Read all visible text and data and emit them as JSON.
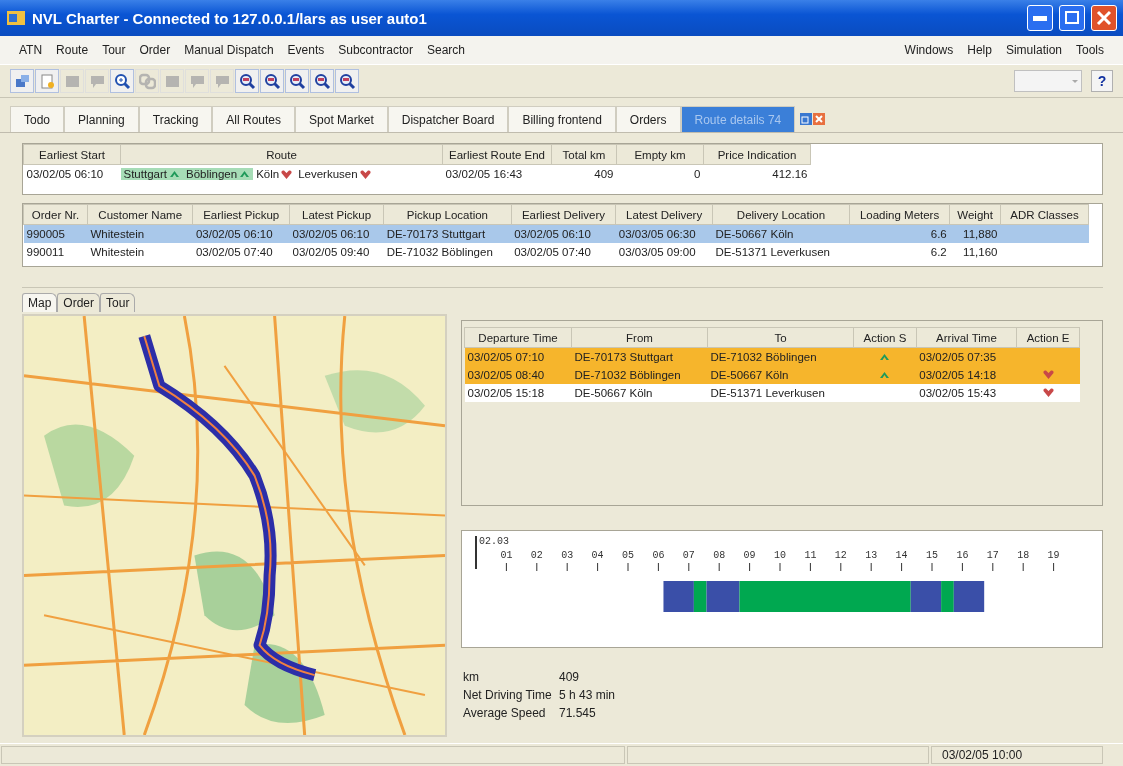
{
  "window": {
    "title": "NVL Charter - Connected to 127.0.0.1/lars as user auto1"
  },
  "menu": {
    "left": [
      "ATN",
      "Route",
      "Tour",
      "Order",
      "Manual Dispatch",
      "Events",
      "Subcontractor",
      "Search"
    ],
    "right": [
      "Windows",
      "Help",
      "Simulation",
      "Tools"
    ]
  },
  "toolbar": [
    {
      "kind": "window",
      "disabled": false
    },
    {
      "kind": "new",
      "disabled": false
    },
    {
      "kind": "grid",
      "disabled": true
    },
    {
      "kind": "note",
      "disabled": true
    },
    {
      "kind": "zoom",
      "disabled": false
    },
    {
      "kind": "link",
      "disabled": true
    },
    {
      "kind": "grid",
      "disabled": true
    },
    {
      "kind": "note",
      "disabled": true
    },
    {
      "kind": "note",
      "disabled": true
    },
    {
      "kind": "search",
      "disabled": false
    },
    {
      "kind": "search",
      "disabled": false
    },
    {
      "kind": "search",
      "disabled": false
    },
    {
      "kind": "search",
      "disabled": false
    },
    {
      "kind": "search",
      "disabled": false
    }
  ],
  "combo": {
    "disabled": true
  },
  "help_button": "?",
  "tabs": [
    {
      "label": "Todo",
      "selected": false
    },
    {
      "label": "Planning",
      "selected": false
    },
    {
      "label": "Tracking",
      "selected": false
    },
    {
      "label": "All Routes",
      "selected": false
    },
    {
      "label": "Spot Market",
      "selected": false
    },
    {
      "label": "Dispatcher Board",
      "selected": false
    },
    {
      "label": "Billing frontend",
      "selected": false
    },
    {
      "label": "Orders",
      "selected": false
    },
    {
      "label": "Route details 74",
      "selected": true
    }
  ],
  "route_table": {
    "columns": [
      "Earliest Start",
      "Route",
      "Earliest Route End",
      "Total km",
      "Empty km",
      "Price Indication"
    ],
    "row": {
      "earliest_start": "03/02/05 06:10",
      "stops": [
        {
          "name": "Stuttgart",
          "kind": "pickup",
          "highlighted": true
        },
        {
          "name": "Böblingen",
          "kind": "pickup",
          "highlighted": true
        },
        {
          "name": "Köln",
          "kind": "delivery",
          "highlighted": false
        },
        {
          "name": "Leverkusen",
          "kind": "delivery",
          "highlighted": false
        }
      ],
      "earliest_route_end": "03/02/05 16:43",
      "total_km": "409",
      "empty_km": "0",
      "price_indication": "412.16"
    }
  },
  "orders_table": {
    "columns": [
      "Order Nr.",
      "Customer Name",
      "Earliest Pickup",
      "Latest Pickup",
      "Pickup Location",
      "Earliest Delivery",
      "Latest Delivery",
      "Delivery Location",
      "Loading Meters",
      "Weight",
      "ADR Classes"
    ],
    "rows": [
      {
        "selected": true,
        "cells": [
          "990005",
          "Whitestein",
          "03/02/05 06:10",
          "03/02/05 06:10",
          "DE-70173 Stuttgart",
          "03/02/05 06:10",
          "03/03/05 06:30",
          "DE-50667 Köln",
          "6.6",
          "11,880"
        ]
      },
      {
        "selected": false,
        "cells": [
          "990011",
          "Whitestein",
          "03/02/05 07:40",
          "03/02/05 09:40",
          "DE-71032 Böblingen",
          "03/02/05 07:40",
          "03/03/05 09:00",
          "DE-51371 Leverkusen",
          "6.2",
          "11,160"
        ]
      }
    ]
  },
  "detail_tabs": [
    {
      "label": "Map",
      "selected": true
    },
    {
      "label": "Order",
      "selected": false
    },
    {
      "label": "Tour",
      "selected": false
    }
  ],
  "legs_table": {
    "columns": [
      "Departure Time",
      "From",
      "To",
      "Action S",
      "Arrival Time",
      "Action E"
    ],
    "rows": [
      {
        "highlighted": true,
        "departure": "03/02/05 07:10",
        "from": "DE-70173 Stuttgart",
        "to": "DE-71032 Böblingen",
        "start_pickup": true,
        "arrival": "03/02/05 07:35",
        "end_delivery": false
      },
      {
        "highlighted": true,
        "departure": "03/02/05 08:40",
        "from": "DE-71032 Böblingen",
        "to": "DE-50667 Köln",
        "start_pickup": true,
        "arrival": "03/02/05 14:18",
        "end_delivery": true
      },
      {
        "highlighted": false,
        "departure": "03/02/05 15:18",
        "from": "DE-50667 Köln",
        "to": "DE-51371 Leverkusen",
        "start_pickup": false,
        "arrival": "03/02/05 15:43",
        "end_delivery": true
      }
    ]
  },
  "timeline": {
    "date": "02.03",
    "hours": [
      "01",
      "02",
      "03",
      "04",
      "05",
      "06",
      "07",
      "08",
      "09",
      "10",
      "11",
      "12",
      "13",
      "14",
      "15",
      "16",
      "17",
      "18",
      "19"
    ]
  },
  "stats": [
    {
      "label": "km",
      "value": "409"
    },
    {
      "label": "Net Driving Time",
      "value": "5 h 43 min"
    },
    {
      "label": "Average Speed",
      "value": "71.545"
    }
  ],
  "status_bar": {
    "time": "03/02/05 10:00"
  }
}
